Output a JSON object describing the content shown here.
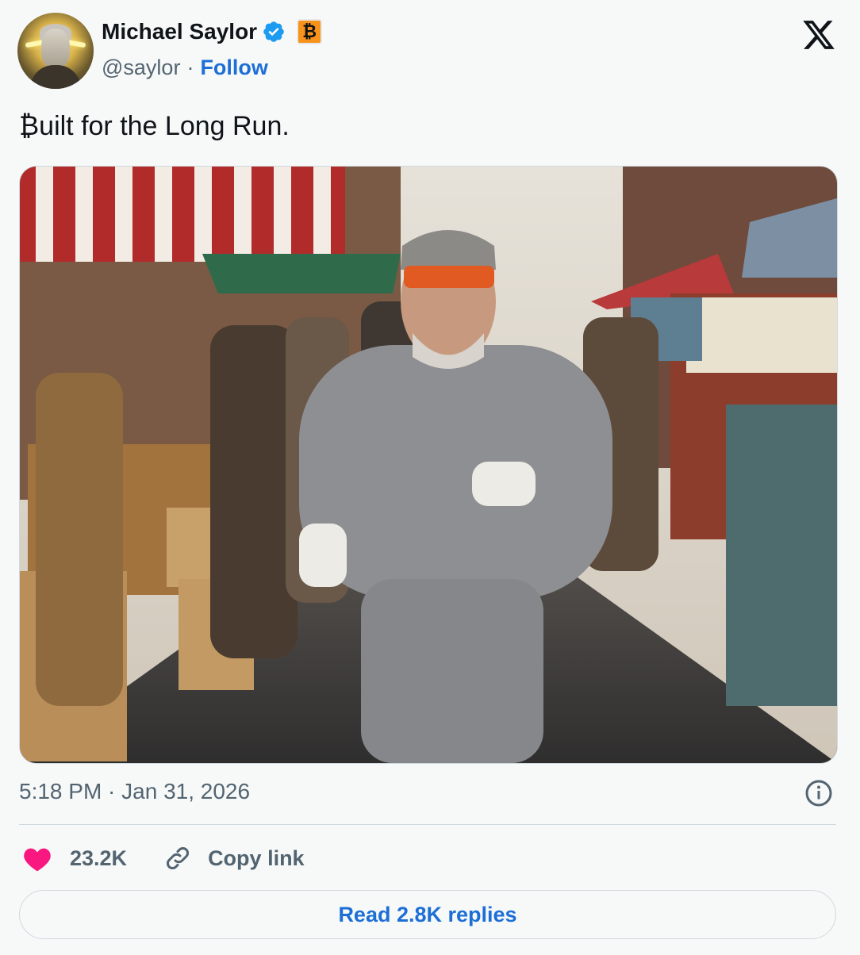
{
  "author": {
    "name": "Michael Saylor",
    "handle": "@saylor",
    "separator": "·",
    "follow_label": "Follow",
    "badge_symbol": "₿",
    "verified_icon": "verified-badge-icon",
    "verified_color": "#1d9bf0",
    "badge_color": "#f7931a"
  },
  "tweet": {
    "text": "₿uilt for the Long Run.",
    "timestamp": "5:18 PM · Jan 31, 2026"
  },
  "actions": {
    "like_count": "23.2K",
    "copy_link_label": "Copy link",
    "read_replies_label": "Read 2.8K replies",
    "heart_color": "#f91880",
    "link_color": "#1d6fd6"
  },
  "media": {
    "description_icon": "photo"
  }
}
